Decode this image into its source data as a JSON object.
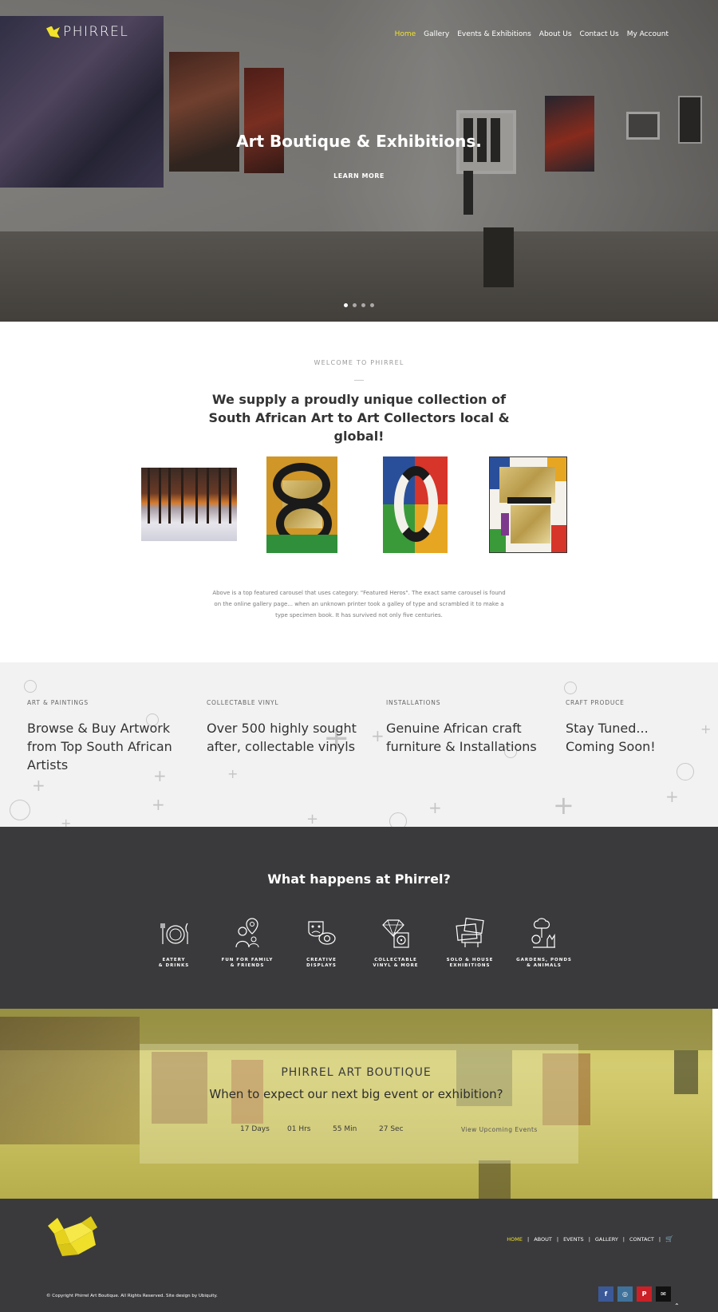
{
  "header": {
    "brand": "PHIRREL",
    "nav": [
      {
        "label": "Home",
        "active": true
      },
      {
        "label": "Gallery",
        "active": false
      },
      {
        "label": "Events & Exhibitions",
        "active": false
      },
      {
        "label": "About Us",
        "active": false
      },
      {
        "label": "Contact Us",
        "active": false
      },
      {
        "label": "My Account",
        "active": false
      }
    ],
    "accent_color": "#f2e22a"
  },
  "hero": {
    "title": "Art Boutique & Exhibitions.",
    "cta": "LEARN MORE",
    "slides": 4,
    "active_slide": 1
  },
  "welcome": {
    "kicker": "WELCOME TO PHIRREL",
    "headline": "We supply a proudly unique collection of South African Art to Art Collectors local & global!",
    "note": "Above is a top featured carousel that uses category: \"Featured Heros\". The exact same carousel is found on the online gallery page... when an unknown printer took a galley of type and scrambled it to make a type specimen book. It has survived not only five centuries."
  },
  "categories": [
    {
      "label": "ART & PAINTINGS",
      "title": "Browse & Buy Artwork from Top South African Artists"
    },
    {
      "label": "COLLECTABLE VINYL",
      "title": "Over 500 highly sought after, collectable vinyls"
    },
    {
      "label": "INSTALLATIONS",
      "title": "Genuine African craft furniture & Installations"
    },
    {
      "label": "CRAFT PRODUCE",
      "title": "Stay Tuned... Coming Soon!"
    }
  ],
  "what_happens": {
    "title": "What happens at Phirrel?",
    "features": [
      {
        "label": "EATERY\n& DRINKS",
        "icon": "plate-cutlery-icon"
      },
      {
        "label": "FUN FOR FAMILY\n& FRIENDS",
        "icon": "family-pin-icon"
      },
      {
        "label": "CREATIVE\nDISPLAYS",
        "icon": "theatre-masks-icon"
      },
      {
        "label": "COLLECTABLE\nVINYL & MORE",
        "icon": "diamond-vinyl-icon"
      },
      {
        "label": "SOLO & HOUSE\nEXHIBITIONS",
        "icon": "exhibition-frames-icon"
      },
      {
        "label": "GARDENS, PONDS\n& ANIMALS",
        "icon": "tree-animals-icon"
      }
    ]
  },
  "countdown": {
    "name": "PHIRREL ART BOUTIQUE",
    "subtitle": "When to expect our next big event or exhibition?",
    "days": "17 Days",
    "hours": "01 Hrs",
    "minutes": "55 Min",
    "seconds": "27 Sec",
    "link": "View Upcoming Events"
  },
  "footer": {
    "nav": [
      {
        "label": "HOME",
        "active": true
      },
      {
        "label": "ABOUT",
        "active": false
      },
      {
        "label": "EVENTS",
        "active": false
      },
      {
        "label": "GALLERY",
        "active": false
      },
      {
        "label": "CONTACT",
        "active": false
      }
    ],
    "separator": "|",
    "copyright": "© Copyright Phirrel Art Boutique. All Rights Reserved. Site design by Ubiquity.",
    "social": [
      {
        "icon": "facebook-icon",
        "glyph": "f",
        "color": "#3b5998"
      },
      {
        "icon": "instagram-icon",
        "glyph": "◎",
        "color": "#3f729b"
      },
      {
        "icon": "pinterest-icon",
        "glyph": "P",
        "color": "#cb2027"
      },
      {
        "icon": "email-icon",
        "glyph": "✉",
        "color": "#111111"
      }
    ]
  }
}
